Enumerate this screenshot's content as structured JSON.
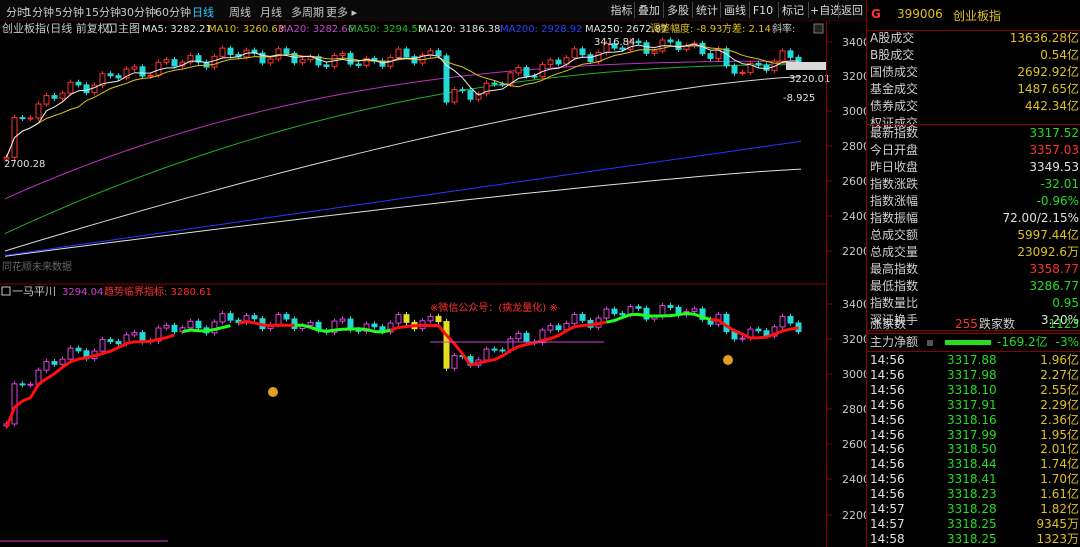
{
  "toolbar": {
    "periods": [
      "分时",
      "1分钟",
      "5分钟",
      "15分钟",
      "30分钟",
      "60分钟",
      "日线",
      "周线",
      "月线",
      "多周期",
      "更多 ▸"
    ],
    "active_period": "日线",
    "buttons": [
      "指标",
      "叠加",
      "多股",
      "统计",
      "画线",
      "F10",
      "标记",
      "+自选",
      "返回"
    ]
  },
  "main_chart": {
    "title": "创业板指(日线 前复权)",
    "tab_label": "主图",
    "ma": [
      {
        "label": "MA5: 3282.21",
        "color": "#e0e0e0"
      },
      {
        "label": "MA10: 3260.63",
        "color": "#e0c020"
      },
      {
        "label": "MA20: 3282.66",
        "color": "#d040d0"
      },
      {
        "label": "MA50: 3294.55",
        "color": "#20c020"
      },
      {
        "label": "MA120: 3186.38",
        "color": "#e0e0e0"
      },
      {
        "label": "MA200: 2928.92",
        "color": "#3040ff"
      },
      {
        "label": "MA250: 2672.87",
        "color": "#e0e0e0"
      }
    ],
    "adjust_label": "调整幅度: -8.93",
    "variance_label": "方差: 2.14",
    "slope_label": "斜率:",
    "hi_label": "3416.84",
    "lo_label": "2700.28",
    "last_label": "3220.01",
    "drop_label": "-8.925",
    "watermark": "同花顺未来数据",
    "y_ticks": [
      "3400",
      "3200",
      "3000",
      "2800",
      "2600",
      "2400",
      "2200"
    ]
  },
  "sub_chart": {
    "name": "一马平川",
    "v1_label": "3294.04",
    "v2_label": "趋势临界指标: 3280.61",
    "promo": "※微信公众号：(擒龙量化) ※",
    "y_ticks": [
      "3400",
      "3200",
      "3000",
      "2800",
      "2600",
      "2400",
      "2200"
    ]
  },
  "panel": {
    "flag": "G",
    "code": "399006",
    "name": "创业板指",
    "stats": [
      {
        "label": "A股成交",
        "value": "13636.28亿",
        "color": "#e0c020"
      },
      {
        "label": "B股成交",
        "value": "0.54亿",
        "color": "#e0c020"
      },
      {
        "label": "国债成交",
        "value": "2692.92亿",
        "color": "#e0c020"
      },
      {
        "label": "基金成交",
        "value": "1487.65亿",
        "color": "#e0c020"
      },
      {
        "label": "债券成交",
        "value": "442.34亿",
        "color": "#e0c020"
      },
      {
        "label": "权证成交",
        "value": "",
        "color": "#e0c020"
      }
    ],
    "quotes": [
      {
        "label": "最新指数",
        "value": "3317.52",
        "color": "#22dd22"
      },
      {
        "label": "今日开盘",
        "value": "3357.03",
        "color": "#ff3030"
      },
      {
        "label": "昨日收盘",
        "value": "3349.53",
        "color": "#e0e0e0"
      },
      {
        "label": "指数涨跌",
        "value": "-32.01",
        "color": "#22dd22"
      },
      {
        "label": "指数涨幅",
        "value": "-0.96%",
        "color": "#22dd22"
      },
      {
        "label": "指数振幅",
        "value": "72.00/2.15%",
        "color": "#e0e0e0"
      },
      {
        "label": "总成交额",
        "value": "5997.44亿",
        "color": "#e0c020"
      },
      {
        "label": "总成交量",
        "value": "23092.6万",
        "color": "#e0c020"
      },
      {
        "label": "最高指数",
        "value": "3358.77",
        "color": "#ff3030"
      },
      {
        "label": "最低指数",
        "value": "3286.77",
        "color": "#22dd22"
      },
      {
        "label": "指数量比",
        "value": "0.95",
        "color": "#22dd22"
      },
      {
        "label": "深证换手",
        "value": "3.20%",
        "color": "#e0e0e0"
      }
    ],
    "rise_label": "涨家数",
    "rise_value": "255",
    "fall_label": "跌家数",
    "fall_value": "1123",
    "flow_label": "主力净额",
    "flow_value": "-169.2亿",
    "flow_pct": "-3%",
    "ticks": [
      {
        "time": "14:56",
        "price": "3317.88",
        "vol": "1.96亿"
      },
      {
        "time": "14:56",
        "price": "3317.98",
        "vol": "2.27亿"
      },
      {
        "time": "14:56",
        "price": "3318.10",
        "vol": "2.55亿"
      },
      {
        "time": "14:56",
        "price": "3317.91",
        "vol": "2.29亿"
      },
      {
        "time": "14:56",
        "price": "3318.16",
        "vol": "2.36亿"
      },
      {
        "time": "14:56",
        "price": "3317.99",
        "vol": "1.95亿"
      },
      {
        "time": "14:56",
        "price": "3318.50",
        "vol": "2.01亿"
      },
      {
        "time": "14:56",
        "price": "3318.44",
        "vol": "1.74亿"
      },
      {
        "time": "14:56",
        "price": "3318.41",
        "vol": "1.70亿"
      },
      {
        "time": "14:56",
        "price": "3318.23",
        "vol": "1.61亿"
      },
      {
        "time": "14:57",
        "price": "3318.28",
        "vol": "1.82亿"
      },
      {
        "time": "14:57",
        "price": "3318.25",
        "vol": "9345万"
      },
      {
        "time": "14:58",
        "price": "3318.25",
        "vol": "1323万"
      }
    ]
  }
}
